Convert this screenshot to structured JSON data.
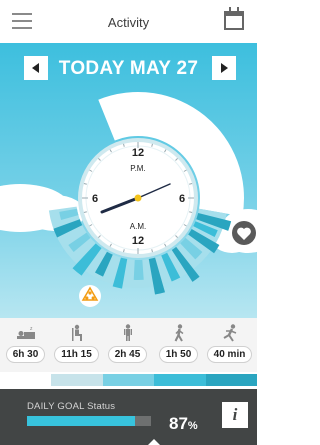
{
  "header": {
    "title": "Activity",
    "menu_icon": "hamburger-menu-icon",
    "calendar_icon": "calendar-icon"
  },
  "date_nav": {
    "label": "TODAY MAY 27",
    "prev_icon": "triangle-left-icon",
    "next_icon": "triangle-right-icon"
  },
  "clock": {
    "pm_hour": "12",
    "pm_label": "P.M.",
    "am_hour": "12",
    "am_label": "A.M.",
    "left_hour": "6",
    "right_hour": "6"
  },
  "activities": [
    {
      "icon": "sleep-icon",
      "value": "6h 30"
    },
    {
      "icon": "sitting-icon",
      "value": "11h 15"
    },
    {
      "icon": "standing-icon",
      "value": "2h 45"
    },
    {
      "icon": "walking-icon",
      "value": "1h 50"
    },
    {
      "icon": "running-icon",
      "value": "40 min"
    }
  ],
  "strip_colors": [
    "#ffffff",
    "#c7e3ea",
    "#78d0e4",
    "#3cbdd8",
    "#2aa5c0"
  ],
  "goal": {
    "label": "DAILY GOAL Status",
    "percent_value": "87",
    "percent_sign": "%",
    "fraction": 0.87,
    "info_label": "i"
  },
  "colors": {
    "accent": "#38c3dd",
    "panel": "#424545",
    "warning": "#f39c12"
  }
}
